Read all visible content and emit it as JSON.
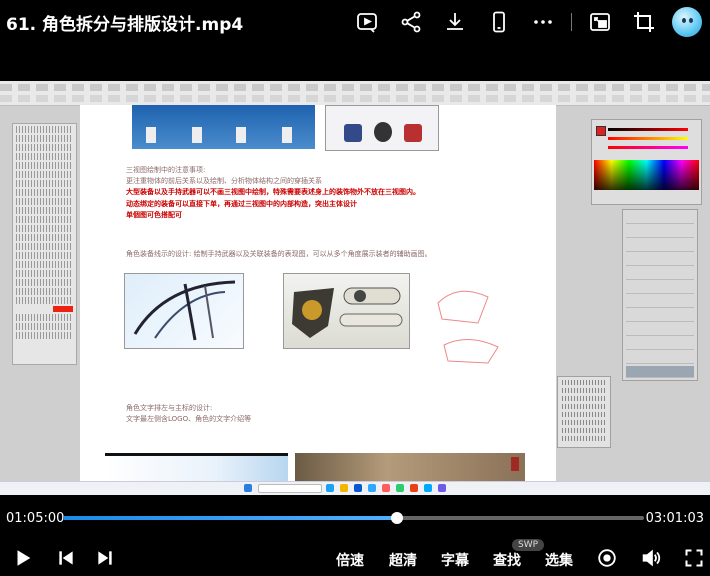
{
  "window": {
    "title": "61. 角色拆分与排版设计.mp4"
  },
  "toolbar_icons": [
    "screen-record-icon",
    "share-icon",
    "download-icon",
    "phone-icon",
    "more-icon",
    "pip-icon",
    "crop-icon"
  ],
  "video": {
    "canvas_text": {
      "block1": [
        "三视图绘制中的注意事项:",
        "更注重物体的前后关系以及绘制、分析物体结构之间的穿插关系"
      ],
      "block1_red": [
        "大型装备以及手持武器可以不画三视图中绘制，特殊需要表述身上的装饰物外不放在三视图内。",
        "动态绑定的装备可以直接下单，再通过三视图中的内部构造，突出主体设计",
        "单個图可色搭配可"
      ],
      "block2": "角色装备线示的设计: 绘制手持武器以及关联装备的表现图，可以从多个角度展示装者的辅助画图。",
      "block3": [
        "角色文字排左与主标的设计:",
        "文字最左侧含LOGO、角色的文字介绍等"
      ]
    }
  },
  "player": {
    "current_time": "01:05:00",
    "total_time": "03:01:03",
    "progress": 0.575,
    "labels": {
      "speed": "倍速",
      "quality": "超清",
      "subtitle": "字幕",
      "search": "查找",
      "episodes": "选集"
    },
    "badge": "SWP"
  },
  "colors": {
    "accent": "#1c8be8",
    "background": "#000000",
    "track": "#666666"
  }
}
